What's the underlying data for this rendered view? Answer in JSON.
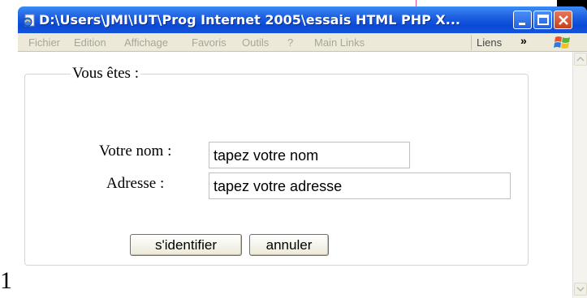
{
  "window": {
    "title": "D:\\Users\\JMI\\IUT\\Prog Internet 2005\\essais HTML PHP X...",
    "icon": "ie-page-icon",
    "controls": [
      "minimize-icon",
      "maximize-icon",
      "close-icon"
    ]
  },
  "menubar": {
    "items": [
      "Fichier",
      "Edition",
      "Affichage",
      "Favoris",
      "Outils",
      "?",
      "Main Links"
    ],
    "links_label": "Liens",
    "chevron": "»"
  },
  "form": {
    "legend": "Vous êtes :",
    "name_label": "Votre nom :",
    "name_value": "tapez votre nom",
    "address_label": "Adresse :",
    "address_value": "tapez votre adresse",
    "submit_label": "s'identifier",
    "cancel_label": "annuler"
  },
  "page_edge": {
    "left_glyph": "1"
  },
  "colors": {
    "titlebar": "#0a4ad8",
    "menubar": "#ece9d8",
    "close_button": "#c8401c",
    "accent_line": "#e0529a"
  }
}
